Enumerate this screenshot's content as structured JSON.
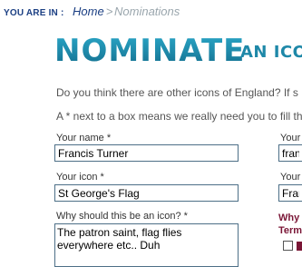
{
  "breadcrumb": {
    "prefix": "YOU ARE IN :",
    "home": "Home",
    "separator": ">",
    "current": "Nominations"
  },
  "header": {
    "title": "NOMINATE",
    "subtitle": "AN ICO"
  },
  "intro": {
    "question": "Do you think there are other icons of England? If s",
    "required_note": "A * next to a box means we really need you to fill th"
  },
  "form": {
    "name": {
      "label": "Your name *",
      "value": "Francis Turner"
    },
    "icon": {
      "label": "Your icon *",
      "value": "St George's Flag"
    },
    "reason": {
      "label": "Why should this be an icon? *",
      "value": "The patron saint, flag flies everywhere etc.. Duh"
    }
  },
  "right_column": {
    "label_1": "Your",
    "value_1": "franc",
    "label_2": "Your",
    "value_2": "Fran",
    "heading_1": "Why",
    "heading_2": "Term"
  },
  "colors": {
    "link_blue": "#1b3f83",
    "title_teal": "#1e88a8",
    "muted_grey": "#9aa6ad",
    "maroon": "#7a1636",
    "input_border": "#4d6f87"
  }
}
